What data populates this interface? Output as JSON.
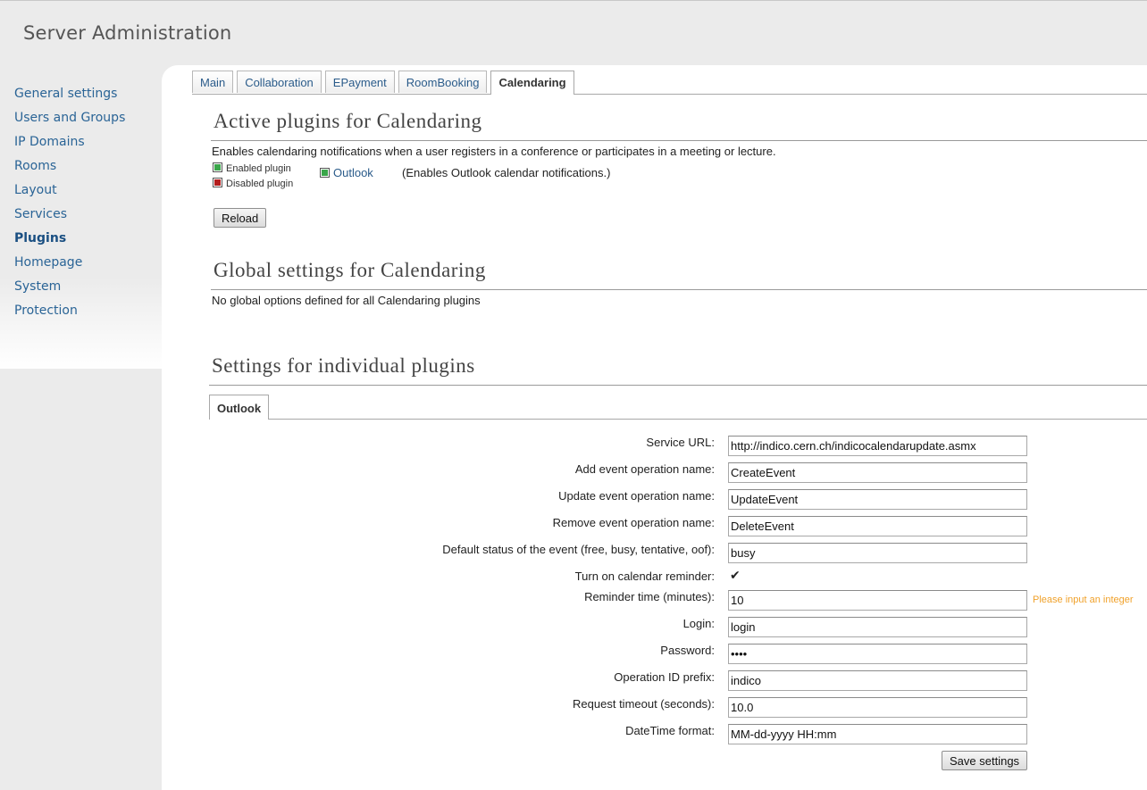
{
  "header": {
    "title": "Server Administration"
  },
  "sidebar": {
    "items": [
      {
        "label": "General settings"
      },
      {
        "label": "Users and Groups"
      },
      {
        "label": "IP Domains"
      },
      {
        "label": "Rooms"
      },
      {
        "label": "Layout"
      },
      {
        "label": "Services"
      },
      {
        "label": "Plugins",
        "active": true
      },
      {
        "label": "Homepage"
      },
      {
        "label": "System"
      },
      {
        "label": "Protection"
      }
    ]
  },
  "tabs": [
    {
      "label": "Main"
    },
    {
      "label": "Collaboration"
    },
    {
      "label": "EPayment"
    },
    {
      "label": "RoomBooking"
    },
    {
      "label": "Calendaring",
      "active": true
    }
  ],
  "active_plugins": {
    "title": "Active plugins for Calendaring",
    "description": "Enables calendaring notifications when a user registers in a conference or participates in a meeting or lecture.",
    "legend": {
      "enabled_label": "Enabled plugin",
      "disabled_label": "Disabled plugin"
    },
    "plugin": {
      "name": "Outlook",
      "description": "(Enables Outlook calendar notifications.)",
      "status": "enabled"
    },
    "reload_label": "Reload"
  },
  "global_settings": {
    "title": "Global settings for Calendaring",
    "message": "No global options defined for all Calendaring plugins"
  },
  "individual_settings": {
    "title": "Settings for individual plugins",
    "tab_label": "Outlook",
    "fields": {
      "service_url": {
        "label": "Service URL:",
        "value": "http://indico.cern.ch/indicocalendarupdate.asmx"
      },
      "add_event": {
        "label": "Add event operation name:",
        "value": "CreateEvent"
      },
      "update_event": {
        "label": "Update event operation name:",
        "value": "UpdateEvent"
      },
      "remove_event": {
        "label": "Remove event operation name:",
        "value": "DeleteEvent"
      },
      "default_status": {
        "label": "Default status of the event (free, busy, tentative, oof):",
        "value": "busy"
      },
      "reminder": {
        "label": "Turn on calendar reminder:",
        "checked": true,
        "check_glyph": "✔"
      },
      "reminder_time": {
        "label": "Reminder time (minutes):",
        "value": "10",
        "hint": "Please input an integer"
      },
      "login": {
        "label": "Login:",
        "value": "login"
      },
      "password": {
        "label": "Password:",
        "value": "••••"
      },
      "operation_id_prefix": {
        "label": "Operation ID prefix:",
        "value": "indico"
      },
      "request_timeout": {
        "label": "Request timeout (seconds):",
        "value": "10.0"
      },
      "datetime_format": {
        "label": "DateTime format:",
        "value": "MM-dd-yyyy HH:mm"
      }
    },
    "save_label": "Save settings"
  },
  "colors": {
    "link": "#2a6496",
    "enabled": "#3aa64a",
    "disabled": "#b41e1e",
    "hint": "#f0a12a"
  }
}
